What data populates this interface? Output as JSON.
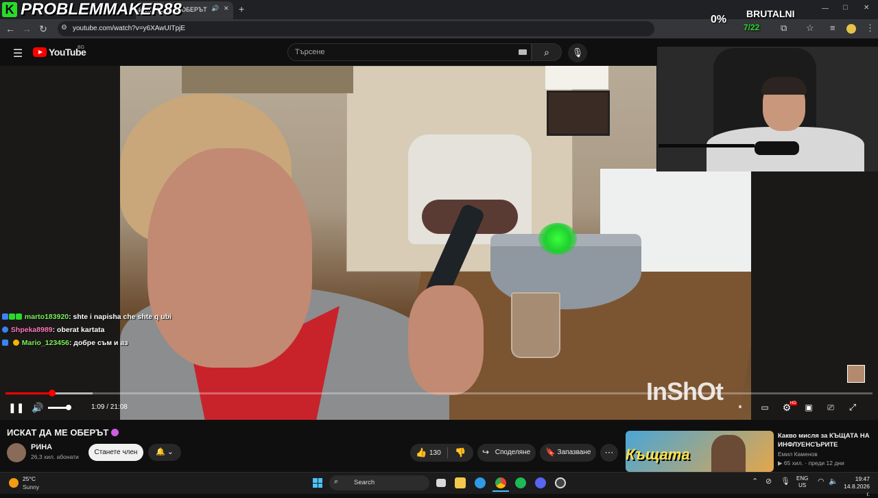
{
  "overlay": {
    "streamer_name": "PROBLEMMAKER88",
    "logo_letter": "K",
    "percent": "0%",
    "challenge": "BRUTALNI",
    "score": "7/22"
  },
  "browser": {
    "tab_title": "ИСКАТ ДА МЕ ОБЕРЪТ",
    "new_tab": "+",
    "url": "youtube.com/watch?v=y6XAwUITpjE",
    "minimize": "—",
    "maximize": "□",
    "close": "✕"
  },
  "youtube": {
    "brand": "YouTube",
    "region": "BG",
    "search_placeholder": "Търсене"
  },
  "chat": [
    {
      "user": "marto183920",
      "message": ": shte i napisha che shte q ubi",
      "color": "#7cf25a"
    },
    {
      "user": "Shpeka8989",
      "message": ": oberat kartata",
      "color": "#ff7ab8"
    },
    {
      "user": "Mario_123456",
      "message": ": добре съм и аз",
      "color": "#7cf25a"
    }
  ],
  "player": {
    "time": "1:09 / 21:08",
    "progress": 0.054,
    "volume": 0.8,
    "watermark": "InShOt",
    "settings_badge": "HD"
  },
  "video": {
    "title": "ИСКАТ ДА МЕ ОБЕРЪТ",
    "channel": "РИНА",
    "subscribers": "26,3 хил. абонати",
    "join_label": "Станете член",
    "likes": "130",
    "share_label": "Споделяне",
    "save_label": "Запазване",
    "more_label": "⋯"
  },
  "recommendation": {
    "title": "Какво мисля за КЪЩАТА НА ИНФЛУЕНСЪРИТЕ",
    "channel": "Емил Каменов",
    "meta": "▶ 65 хил. · преди 12 дни",
    "thumb_text": "Къщата"
  },
  "taskbar": {
    "temperature": "25°C",
    "condition": "Sunny",
    "search_label": "Search",
    "lang_top": "ENG",
    "lang_bottom": "US",
    "time": "19:47",
    "date": "14.8.2026 г."
  }
}
